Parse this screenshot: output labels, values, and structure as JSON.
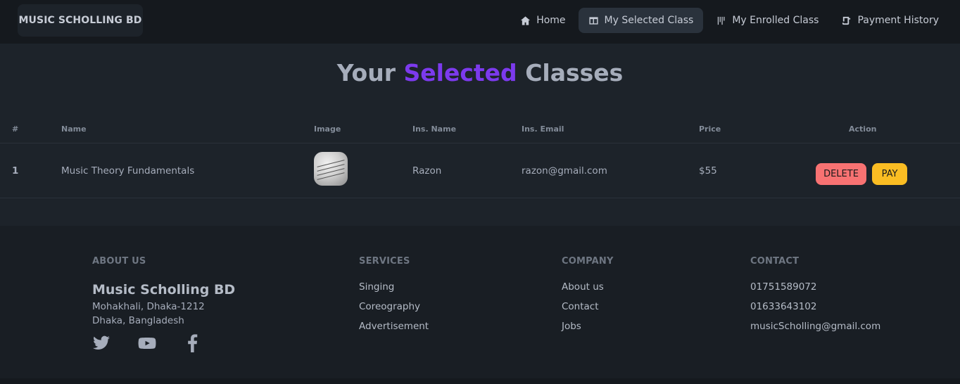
{
  "navbar": {
    "brand": "MUSIC SCHOLLING BD",
    "items": [
      {
        "label": "Home",
        "icon": "home-icon"
      },
      {
        "label": "My Selected Class",
        "icon": "columns-icon",
        "active": true
      },
      {
        "label": "My Enrolled Class",
        "icon": "bars-icon"
      },
      {
        "label": "Payment History",
        "icon": "scroll-icon"
      }
    ]
  },
  "title": {
    "part1": "Your",
    "accent": "Selected",
    "part2": "Classes"
  },
  "table": {
    "headers": [
      "#",
      "Name",
      "Image",
      "Ins. Name",
      "Ins. Email",
      "Price",
      "Action"
    ],
    "rows": [
      {
        "index": "1",
        "name": "Music Theory Fundamentals",
        "ins_name": "Razon",
        "ins_email": "razon@gmail.com",
        "price": "$55",
        "delete_label": "DELETE",
        "pay_label": "PAY"
      }
    ]
  },
  "footer": {
    "about": {
      "heading": "ABOUT US",
      "brand": "Music Scholling BD",
      "line1": "Mohakhali, Dhaka-1212",
      "line2": "Dhaka, Bangladesh"
    },
    "services": {
      "heading": "SERVICES",
      "items": [
        "Singing",
        "Coreography",
        "Advertisement"
      ]
    },
    "company": {
      "heading": "COMPANY",
      "items": [
        "About us",
        "Contact",
        "Jobs"
      ]
    },
    "contact": {
      "heading": "CONTACT",
      "items": [
        "01751589072",
        "01633643102",
        "musicScholling@gmail.com"
      ]
    },
    "social": [
      "twitter-icon",
      "youtube-icon",
      "facebook-icon"
    ]
  },
  "colors": {
    "accent": "#7c3aed",
    "delete": "#f87272",
    "pay": "#fbbd23",
    "background": "#1d232a"
  }
}
